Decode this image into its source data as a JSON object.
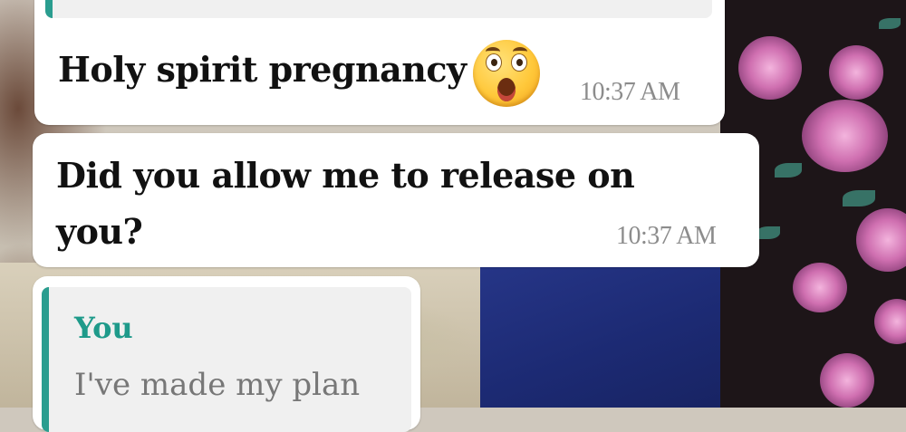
{
  "messages": [
    {
      "text": "Holy spirit pregnancy",
      "emoji": "astonished-face-emoji",
      "time": "10:37 AM"
    },
    {
      "text_line1": "Did you allow me to release on",
      "text_line2": "you?",
      "time": "10:37 AM"
    },
    {
      "quote_sender": "You",
      "quote_text": "I've made my plan"
    }
  ],
  "colors": {
    "bubble": "#ffffff",
    "quote_bar": "#2a9d8f",
    "quote_sender": "#1e9a8a",
    "timestamp": "#8c8c8c"
  }
}
